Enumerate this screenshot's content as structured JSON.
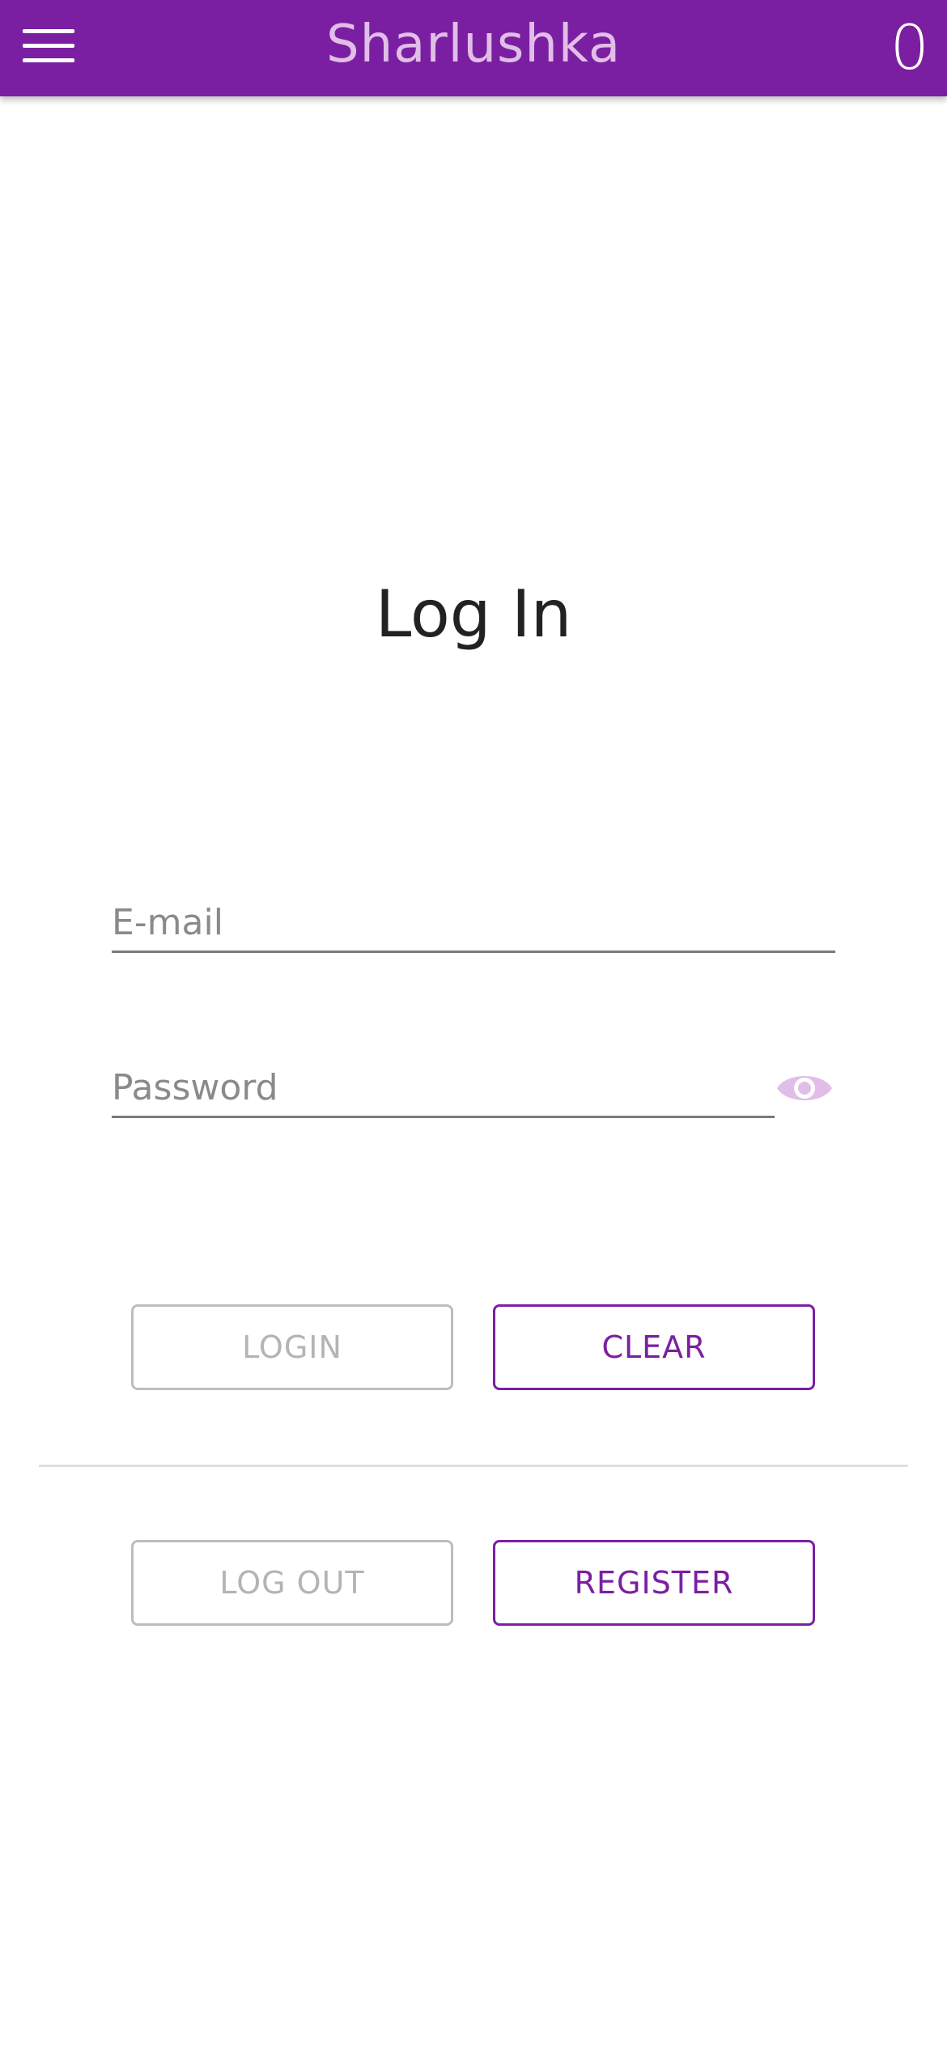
{
  "header": {
    "menu_icon": "hamburger-menu-icon",
    "title": "Sharlushka",
    "cart_count": "0"
  },
  "page": {
    "title": "Log In"
  },
  "form": {
    "email": {
      "placeholder": "E-mail",
      "value": ""
    },
    "password": {
      "placeholder": "Password",
      "value": "",
      "toggle_icon": "eye-icon"
    }
  },
  "buttons": {
    "login": "LOGIN",
    "clear": "CLEAR",
    "logout": "LOG OUT",
    "register": "REGISTER"
  },
  "colors": {
    "primary": "#7b1fa2",
    "title_text": "#e1bee7",
    "eye_icon": "#e1bee7",
    "disabled": "#bdbdbd"
  }
}
